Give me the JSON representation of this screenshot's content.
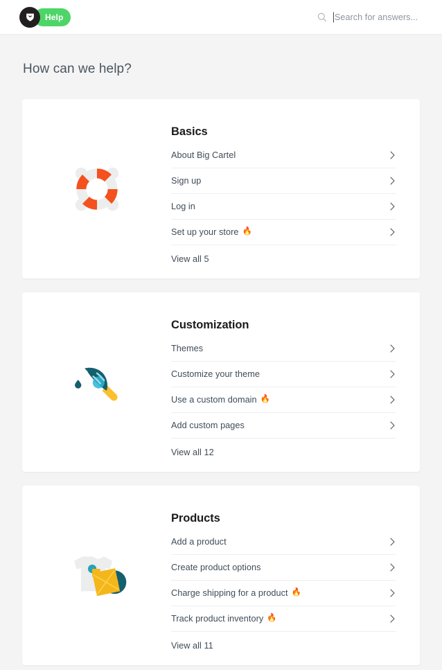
{
  "header": {
    "logo_name": "big-cartel-bird",
    "help_label": "Help",
    "help_pill_color": "#4ed568",
    "logo_bg_color": "#231f20",
    "search": {
      "placeholder": "Search for answers...",
      "value": "",
      "icon": "search-icon"
    }
  },
  "page": {
    "title": "How can we help?"
  },
  "sections": [
    {
      "title": "Basics",
      "art": "life-ring-illustration",
      "links": [
        {
          "label": "About Big Cartel",
          "hot": false
        },
        {
          "label": "Sign up",
          "hot": false
        },
        {
          "label": "Log in",
          "hot": false
        },
        {
          "label": "Set up your store",
          "hot": true
        }
      ],
      "view_all": "View all 5"
    },
    {
      "title": "Customization",
      "art": "paintbrush-illustration",
      "links": [
        {
          "label": "Themes",
          "hot": false
        },
        {
          "label": "Customize your theme",
          "hot": false
        },
        {
          "label": "Use a custom domain",
          "hot": true
        },
        {
          "label": "Add custom pages",
          "hot": false
        }
      ],
      "view_all": "View all 12"
    },
    {
      "title": "Products",
      "art": "tshirt-record-illustration",
      "links": [
        {
          "label": "Add a product",
          "hot": false
        },
        {
          "label": "Create product options",
          "hot": false
        },
        {
          "label": "Charge shipping for a product",
          "hot": true
        },
        {
          "label": "Track product inventory",
          "hot": true
        }
      ],
      "view_all": "View all 11"
    }
  ],
  "icons": {
    "flame": "🔥",
    "chevron": "chevron-right-icon"
  },
  "colors": {
    "page_bg": "#f4f4f4",
    "card_bg": "#ffffff",
    "accent_orange": "#f4511e",
    "accent_green": "#4ed568",
    "text_dark": "#3f4c58",
    "heading": "#1b1b1d"
  }
}
